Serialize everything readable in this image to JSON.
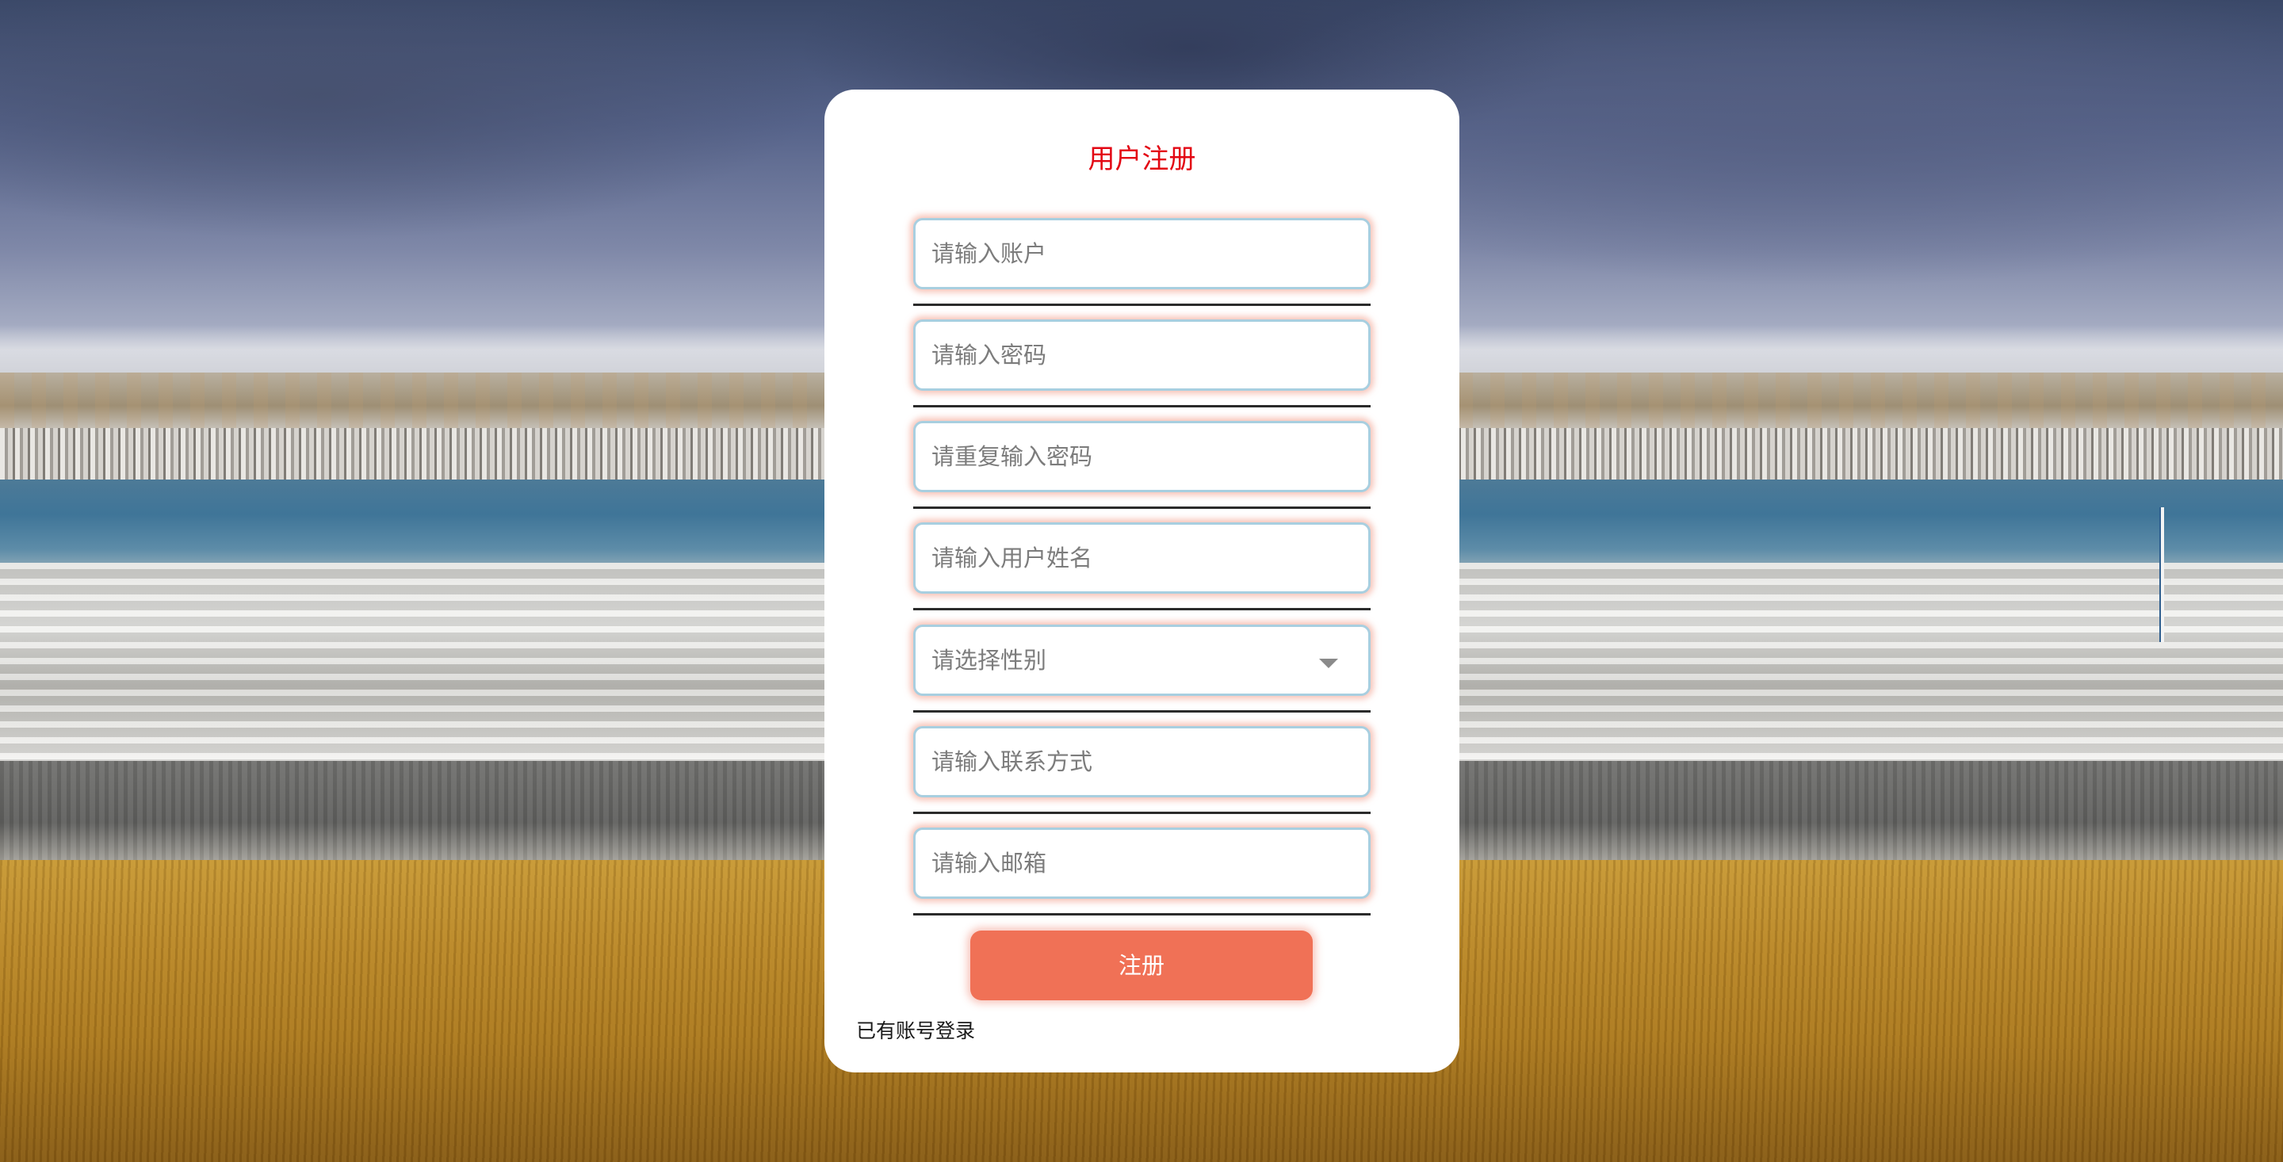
{
  "form": {
    "title": "用户注册",
    "fields": [
      {
        "name": "account",
        "placeholder": "请输入账户",
        "type": "text"
      },
      {
        "name": "password",
        "placeholder": "请输入密码",
        "type": "password"
      },
      {
        "name": "confirm_password",
        "placeholder": "请重复输入密码",
        "type": "password"
      },
      {
        "name": "real_name",
        "placeholder": "请输入用户姓名",
        "type": "text"
      },
      {
        "name": "gender",
        "placeholder": "请选择性别",
        "type": "select"
      },
      {
        "name": "contact",
        "placeholder": "请输入联系方式",
        "type": "text"
      },
      {
        "name": "email",
        "placeholder": "请输入邮箱",
        "type": "text"
      }
    ],
    "submit_label": "注册",
    "login_link_label": "已有账号登录"
  },
  "colors": {
    "title": "#e30613",
    "button": "#f07156",
    "card": "#ffffff"
  },
  "icons": {
    "gender_select": "chevron-down-icon"
  }
}
